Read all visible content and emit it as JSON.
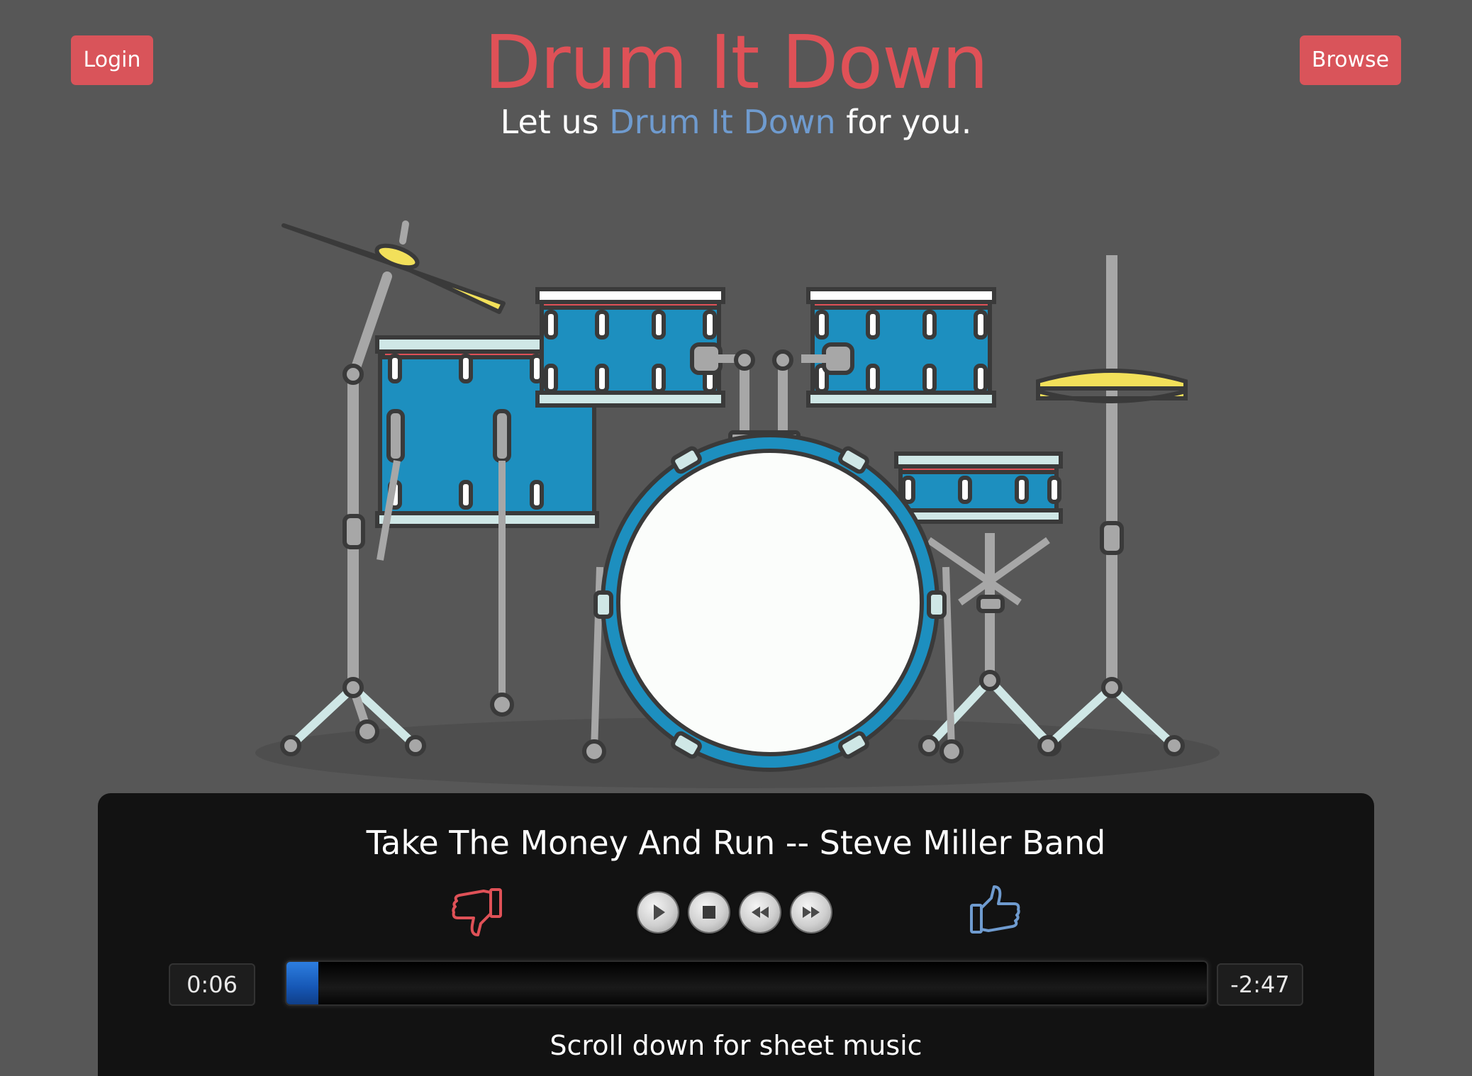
{
  "header": {
    "login_label": "Login",
    "browse_label": "Browse",
    "title": "Drum It Down",
    "tagline_before": "Let us ",
    "tagline_accent": "Drum It Down",
    "tagline_after": " for you."
  },
  "colors": {
    "brand_red": "#df5157",
    "accent_blue": "#6f9bcf",
    "drum_blue": "#1d8fbf",
    "cymbal_yellow": "#f2e05a",
    "background": "#575757",
    "player_bg": "#121212"
  },
  "player": {
    "song_title": "Take The Money And Run -- Steve Miller Band",
    "elapsed": "0:06",
    "remaining": "-2:47",
    "progress_fraction": 0.035,
    "scroll_hint": "Scroll down for sheet music",
    "controls": [
      {
        "icon": "play-icon"
      },
      {
        "icon": "stop-icon"
      },
      {
        "icon": "rewind-icon"
      },
      {
        "icon": "fast-forward-icon"
      }
    ],
    "dislike_icon": "thumbs-down-icon",
    "like_icon": "thumbs-up-icon"
  }
}
